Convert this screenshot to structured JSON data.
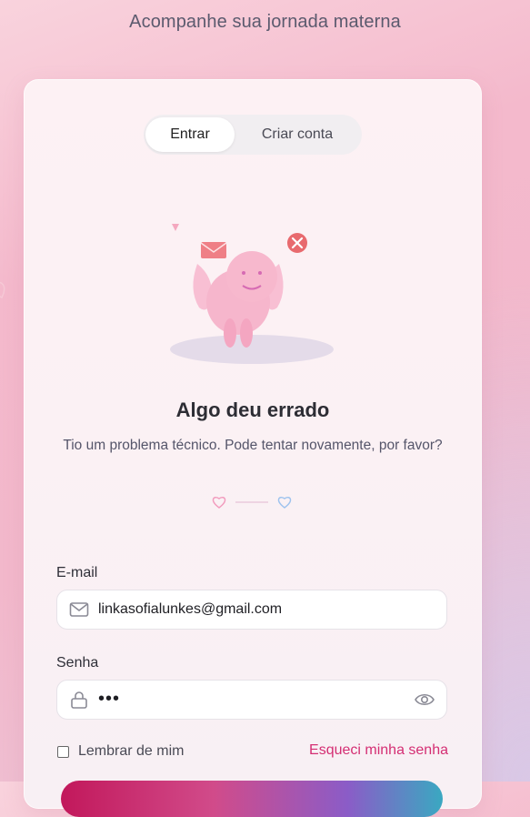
{
  "header": {
    "subtitle": "Acompanhe sua jornada materna"
  },
  "tabs": [
    {
      "label": "Entrar",
      "active": true
    },
    {
      "label": "Criar conta",
      "active": false
    }
  ],
  "error": {
    "title": "Algo deu errado",
    "message": "Tio um problema técnico. Pode tentar novamente, por favor?"
  },
  "form": {
    "email_label": "E-mail",
    "email_value": "linkasofialunkes@gmail.com",
    "password_label": "Senha",
    "password_value": "•••",
    "remember_label": "Lembrar de mim",
    "remember_checked": false,
    "forgot_label": "Esqueci minha senha"
  },
  "colors": {
    "accent": "#d42e73",
    "error_icon": "#e86a6e"
  },
  "icons": [
    "heart-outline-icon",
    "envelope-icon",
    "error-x-icon",
    "mail-icon",
    "lock-icon",
    "eye-icon"
  ]
}
